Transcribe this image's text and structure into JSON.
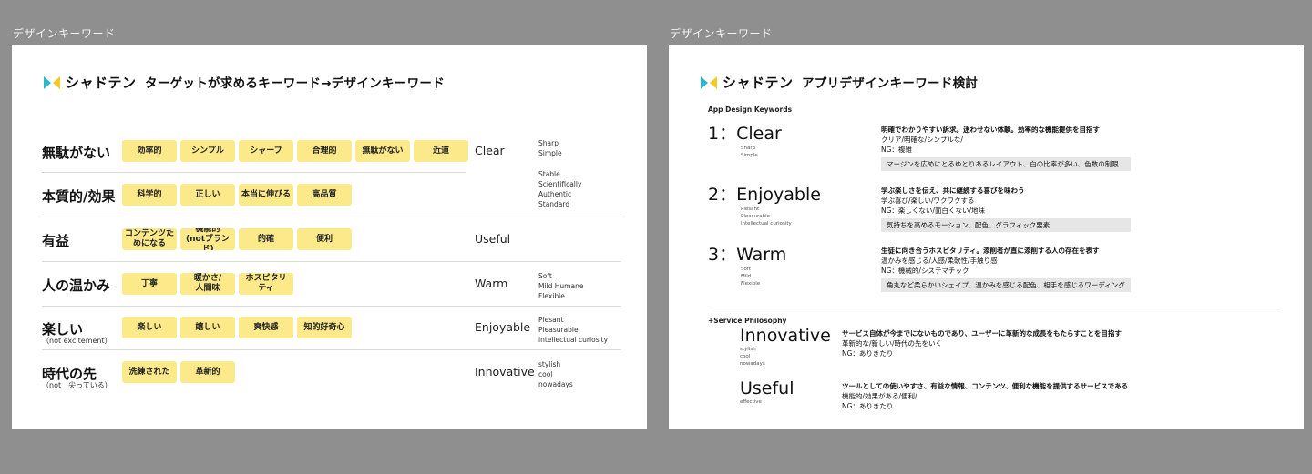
{
  "frame_label": "デザインキーワード",
  "logo_text": "シャドテン",
  "left": {
    "title": "ターゲットが求めるキーワード→デザインキーワード",
    "rows": [
      {
        "label": "無駄がない",
        "sub": "",
        "tags": [
          "効率的",
          "シンプル",
          "シャープ",
          "合理的",
          "無駄がない",
          "近道"
        ],
        "key": "Clear",
        "subs": [
          "Sharp",
          "Simple"
        ]
      },
      {
        "label": "本質的/効果",
        "sub": "",
        "tags": [
          "科学的",
          "正しい",
          "本当に伸びる",
          "高品質"
        ],
        "key": "",
        "subs": [
          "Stable",
          "Scientifically",
          "Authentic",
          "Standard"
        ]
      },
      {
        "label": "有益",
        "sub": "",
        "tags": [
          "コンテンツた\nめになる",
          "機能的\n(notブランド)",
          "的確",
          "便利"
        ],
        "key": "Useful",
        "subs": []
      },
      {
        "label": "人の温かみ",
        "sub": "",
        "tags": [
          "丁寧",
          "暖かさ/\n人間味",
          "ホスピタリ\nティ"
        ],
        "key": "Warm",
        "subs": [
          "Soft",
          "Mild Humane",
          "Flexible"
        ]
      },
      {
        "label": "楽しい",
        "sub": "（not excitement）",
        "tags": [
          "楽しい",
          "嬉しい",
          "爽快感",
          "知的好奇心"
        ],
        "key": "Enjoyable",
        "subs": [
          "Plesant",
          "Pleasurable",
          "intellectual curiosity"
        ]
      },
      {
        "label": "時代の先",
        "sub": "（not　尖っている）",
        "tags": [
          "洗練された",
          "革新的"
        ],
        "key": "Innovative",
        "subs": [
          "stylish",
          "cool",
          "nowadays"
        ]
      }
    ]
  },
  "right": {
    "title": "アプリデザインキーワード検討",
    "section_label": "App Design Keywords",
    "keywords": [
      {
        "num": "1：Clear",
        "subs": [
          "Sharp",
          "Simple"
        ],
        "lead": "明確でわかりやすい訴求。迷わせない体験。効率的な機能提供を目指す",
        "lines": [
          "クリア/明確な/シンプルな/",
          "NG：複雑"
        ],
        "note": "マージンを広めにとるゆとりあるレイアウト、白の比率が多い、色数の制限"
      },
      {
        "num": "2：Enjoyable",
        "subs": [
          "Plesant",
          "Pleasurable",
          "intellectual curiosity"
        ],
        "lead": "学ぶ楽しさを伝え、共に継続する喜びを味わう",
        "lines": [
          "学ぶ喜び/楽しい/ワクワクする",
          "NG：楽しくない/面白くない/地味"
        ],
        "note": "気持ちを高めるモーション、配色、グラフィック要素"
      },
      {
        "num": "3：Warm",
        "subs": [
          "Soft",
          "Mild",
          "Flexible"
        ],
        "lead": "生徒に向き合うホスピタリティ。添削者が直に添削する人の存在を表す",
        "lines": [
          "温かみを感じる/人感/柔軟性/手触り感",
          "NG：機械的/システマチック"
        ],
        "note": "角丸など柔らかいシェイプ、温かみを感じる配色、相手を感じるワーディング"
      }
    ],
    "philosophy_label": "+Service Philosophy",
    "philosophy": [
      {
        "word": "Innovative",
        "subs": [
          "stylish",
          "cool",
          "nowadays"
        ],
        "lead": "サービス自体が今までにないものであり、ユーザーに革新的な成長をもたらすことを目指す",
        "lines": [
          "革新的な/新しい/時代の先をいく",
          "NG：ありきたり"
        ]
      },
      {
        "word": "Useful",
        "subs": [
          "effective"
        ],
        "lead": "ツールとしての使いやすさ、有益な情報、コンテンツ、便利な機能を提供するサービスである",
        "lines": [
          "機能的/効果がある/便利/",
          "NG：ありきたり"
        ]
      }
    ]
  }
}
